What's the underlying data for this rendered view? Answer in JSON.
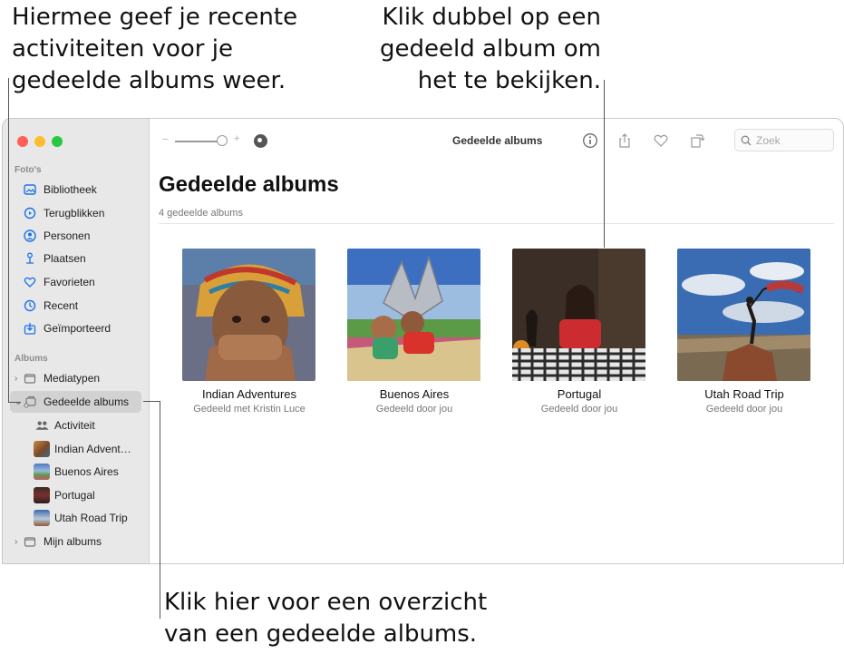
{
  "callouts": {
    "top_left": [
      "Hiermee geef je recente",
      "activiteiten voor je",
      "gedeelde albums weer."
    ],
    "top_right": [
      "Klik dubbel op een",
      "gedeeld album om",
      "het te bekijken."
    ],
    "bottom": [
      "Klik hier voor een overzicht",
      "van een gedeelde albums."
    ]
  },
  "window": {
    "title": "Gedeelde albums",
    "search_placeholder": "Zoek",
    "zoom_minus": "−",
    "zoom_plus": "+"
  },
  "sidebar": {
    "photos_header": "Foto's",
    "photos_items": [
      {
        "label": "Bibliotheek",
        "icon": "library-icon"
      },
      {
        "label": "Terugblikken",
        "icon": "memories-icon"
      },
      {
        "label": "Personen",
        "icon": "people-icon"
      },
      {
        "label": "Plaatsen",
        "icon": "places-icon"
      },
      {
        "label": "Favorieten",
        "icon": "heart-icon"
      },
      {
        "label": "Recent",
        "icon": "clock-icon"
      },
      {
        "label": "Geïmporteerd",
        "icon": "import-icon"
      }
    ],
    "albums_header": "Albums",
    "albums_items": {
      "media_types": "Mediatypen",
      "shared_albums": "Gedeelde albums",
      "activity": "Activiteit",
      "shared_children": [
        "Indian Advent…",
        "Buenos Aires",
        "Portugal",
        "Utah Road Trip"
      ],
      "my_albums": "Mijn albums"
    }
  },
  "main": {
    "title": "Gedeelde albums",
    "subtitle": "4 gedeelde albums",
    "albums": [
      {
        "name": "Indian Adventures",
        "shared": "Gedeeld met Kristin Luce"
      },
      {
        "name": "Buenos Aires",
        "shared": "Gedeeld door jou"
      },
      {
        "name": "Portugal",
        "shared": "Gedeeld door jou"
      },
      {
        "name": "Utah Road Trip",
        "shared": "Gedeeld door jou"
      }
    ]
  },
  "colors": {
    "accent": "#1a73e8",
    "sidebar_bg": "#e8e8e8",
    "selected_bg": "#d2d2d2",
    "close": "#fe5f57",
    "minimize": "#febc2e",
    "zoom": "#28c840"
  }
}
